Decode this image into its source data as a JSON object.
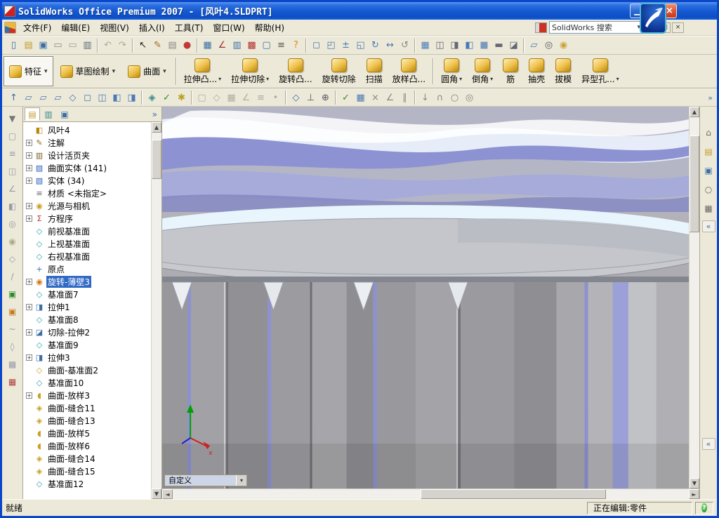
{
  "window": {
    "title": "SolidWorks Office Premium 2007 - [风叶4.SLDPRT]"
  },
  "titlebar": {
    "buttons": [
      {
        "name": "minimize-button",
        "glyph": "▁"
      },
      {
        "name": "restore-button",
        "glyph": "▢"
      },
      {
        "name": "close-button",
        "glyph": "×"
      }
    ]
  },
  "menubar": {
    "items": [
      "文件(F)",
      "编辑(E)",
      "视图(V)",
      "插入(I)",
      "工具(T)",
      "窗口(W)",
      "帮助(H)"
    ],
    "search": {
      "value": "SolidWorks 搜索",
      "arrow": "▾"
    },
    "mdi": [
      {
        "name": "mdi-minimize-button",
        "glyph": "–"
      },
      {
        "name": "mdi-restore-button",
        "glyph": "▢"
      },
      {
        "name": "mdi-close-button",
        "glyph": "×"
      }
    ]
  },
  "toolbar_standard": [
    {
      "n": "new-file-icon",
      "g": "▯",
      "c": "#3a6ea5"
    },
    {
      "n": "open-file-icon",
      "g": "▤",
      "c": "#c49a2e"
    },
    {
      "n": "save-icon",
      "g": "▣",
      "c": "#3a6ea5"
    },
    {
      "n": "make-drawing-icon",
      "g": "▭",
      "c": "#8a8a8a"
    },
    {
      "n": "make-assembly-icon",
      "g": "▭",
      "c": "#9a9a9a"
    },
    {
      "n": "print-icon",
      "g": "▥",
      "c": "#5a6a7a"
    },
    {
      "s": 1
    },
    {
      "n": "undo-icon",
      "g": "↶",
      "c": "#b0aa98"
    },
    {
      "n": "redo-icon",
      "g": "↷",
      "c": "#b0aa98"
    },
    {
      "s": 1
    },
    {
      "n": "select-icon",
      "g": "↖",
      "c": "#222222"
    },
    {
      "n": "sketch-pencil-icon",
      "g": "✎",
      "c": "#a06a20"
    },
    {
      "n": "note-icon",
      "g": "▤",
      "c": "#888888"
    },
    {
      "n": "rebuild-icon",
      "g": "●",
      "c": "#c03838"
    },
    {
      "s": 1
    },
    {
      "n": "grid-icon",
      "g": "▦",
      "c": "#3a6ea5"
    },
    {
      "n": "dimension-icon",
      "g": "∠",
      "c": "#a03030"
    },
    {
      "n": "design-table-icon",
      "g": "▥",
      "c": "#3a6ea5"
    },
    {
      "n": "toolbox-icon",
      "g": "▩",
      "c": "#b03030"
    },
    {
      "n": "window-icon",
      "g": "▢",
      "c": "#3a6ea5"
    },
    {
      "n": "options-icon",
      "g": "≡",
      "c": "#555555"
    },
    {
      "n": "help-icon",
      "g": "?",
      "c": "#e08a00"
    },
    {
      "s": 1
    },
    {
      "n": "zoom-fit-icon",
      "g": "◻",
      "c": "#4a7ab5"
    },
    {
      "n": "zoom-area-icon",
      "g": "◰",
      "c": "#4a7ab5"
    },
    {
      "n": "zoom-in-out-icon",
      "g": "±",
      "c": "#4a7ab5"
    },
    {
      "n": "zoom-selection-icon",
      "g": "◱",
      "c": "#4a7ab5"
    },
    {
      "n": "rotate-view-icon",
      "g": "↻",
      "c": "#4a7ab5"
    },
    {
      "n": "pan-icon",
      "g": "↔",
      "c": "#4a7ab5"
    },
    {
      "n": "previous-view-icon",
      "g": "↺",
      "c": "#888888"
    },
    {
      "s": 1
    },
    {
      "n": "standard-views-icon",
      "g": "▦",
      "c": "#4a7ab5"
    },
    {
      "n": "wireframe-icon",
      "g": "◫",
      "c": "#666677"
    },
    {
      "n": "hidden-lines-icon",
      "g": "◨",
      "c": "#666677"
    },
    {
      "n": "shaded-edges-icon",
      "g": "◧",
      "c": "#4a7ab5"
    },
    {
      "n": "shaded-icon",
      "g": "■",
      "c": "#7a9ac0"
    },
    {
      "n": "shadow-icon",
      "g": "▬",
      "c": "#666677"
    },
    {
      "n": "section-view-icon",
      "g": "◪",
      "c": "#666677"
    },
    {
      "s": 1
    },
    {
      "n": "view-orientation-icon",
      "g": "▱",
      "c": "#4a7ab5"
    },
    {
      "n": "camera-icon",
      "g": "◎",
      "c": "#555566"
    },
    {
      "n": "appearance-icon",
      "g": "◉",
      "c": "#caa23a"
    }
  ],
  "command_manager": {
    "tabs": [
      {
        "label": "特征",
        "name": "tab-features",
        "active": true,
        "arrow": "▾"
      },
      {
        "label": "草图绘制",
        "name": "tab-sketch",
        "active": false,
        "arrow": "▾"
      },
      {
        "label": "曲面",
        "name": "tab-surfaces",
        "active": false,
        "arrow": "▾"
      }
    ],
    "buttons": [
      {
        "label": "拉伸凸...",
        "name": "extruded-boss-button",
        "arrow": true
      },
      {
        "label": "拉伸切除",
        "name": "extruded-cut-button",
        "arrow": true
      },
      {
        "label": "旋转凸...",
        "name": "revolved-boss-button",
        "arrow": false
      },
      {
        "label": "旋转切除",
        "name": "revolved-cut-button",
        "arrow": false
      },
      {
        "label": "扫描",
        "name": "sweep-button",
        "arrow": false
      },
      {
        "label": "放样凸...",
        "name": "loft-button",
        "arrow": false,
        "sep_after": true
      },
      {
        "label": "圆角",
        "name": "fillet-button",
        "arrow": true
      },
      {
        "label": "倒角",
        "name": "chamfer-button",
        "arrow": true
      },
      {
        "label": "筋",
        "name": "rib-button",
        "arrow": false
      },
      {
        "label": "抽壳",
        "name": "shell-button",
        "arrow": false
      },
      {
        "label": "拔模",
        "name": "draft-button",
        "arrow": false
      },
      {
        "label": "异型孔...",
        "name": "hole-wizard-button",
        "arrow": true
      }
    ]
  },
  "toolbar_view": [
    {
      "n": "normal-to-icon",
      "g": "↑",
      "c": "#3a6ea5"
    },
    {
      "n": "front-plane-icon",
      "g": "▱",
      "c": "#4a7ab5"
    },
    {
      "n": "top-plane-icon",
      "g": "▱",
      "c": "#4a7ab5"
    },
    {
      "n": "right-plane-icon",
      "g": "▱",
      "c": "#4a7ab5"
    },
    {
      "n": "iso-view-icon",
      "g": "◇",
      "c": "#4a7ab5"
    },
    {
      "n": "cube-view-1-icon",
      "g": "◻",
      "c": "#4a7ab5"
    },
    {
      "n": "cube-view-2-icon",
      "g": "◫",
      "c": "#4a7ab5"
    },
    {
      "n": "cube-view-3-icon",
      "g": "◧",
      "c": "#4a7ab5"
    },
    {
      "n": "cube-view-4-icon",
      "g": "◨",
      "c": "#4a7ab5"
    },
    {
      "s": 1
    },
    {
      "n": "display-style-icon",
      "g": "◈",
      "c": "#3a8a8a"
    },
    {
      "n": "hide-show-icon",
      "g": "✓",
      "c": "#2a8a2a"
    },
    {
      "n": "appearance-star-icon",
      "g": "✱",
      "c": "#b8a020"
    },
    {
      "s": 1
    },
    {
      "n": "sketch-snap-icon",
      "g": "▢",
      "c": "#b2ae9e"
    },
    {
      "n": "quick-snap-icon",
      "g": "◇",
      "c": "#b2ae9e"
    },
    {
      "n": "grid-snap-icon",
      "g": "▦",
      "c": "#b2ae9e"
    },
    {
      "n": "angle-snap-icon",
      "g": "∠",
      "c": "#b2ae9e"
    },
    {
      "n": "length-snap-icon",
      "g": "≡",
      "c": "#b2ae9e"
    },
    {
      "n": "midpoint-snap-icon",
      "g": "•",
      "c": "#b2ae9e"
    },
    {
      "s": 1
    },
    {
      "n": "polygon-icon",
      "g": "◇",
      "c": "#3a6ea5"
    },
    {
      "n": "datum-icon",
      "g": "⊥",
      "c": "#555566"
    },
    {
      "n": "anchor-icon",
      "g": "⊕",
      "c": "#555566"
    },
    {
      "s": 1
    },
    {
      "n": "green-check-icon",
      "g": "✓",
      "c": "#2a8a2a"
    },
    {
      "n": "layout-icon",
      "g": "▦",
      "c": "#4a7ab5"
    },
    {
      "n": "close-sketch-icon",
      "g": "×",
      "c": "#888888"
    },
    {
      "n": "angle-measure-icon",
      "g": "∠",
      "c": "#888888"
    },
    {
      "n": "parallel-icon",
      "g": "∥",
      "c": "#888888"
    },
    {
      "s": 1
    },
    {
      "n": "arrow-down-icon",
      "g": "↓",
      "c": "#888888"
    },
    {
      "n": "arc-icon",
      "g": "∩",
      "c": "#888888"
    },
    {
      "n": "circle-icon",
      "g": "○",
      "c": "#888888"
    },
    {
      "n": "target-icon",
      "g": "◎",
      "c": "#888888"
    }
  ],
  "toolbar_overflow_glyph": "»",
  "left_strip": [
    {
      "n": "selection-filter-icon",
      "g": "▼",
      "c": "#777777"
    },
    {
      "n": "document-strip-icon",
      "g": "▢",
      "c": "#9999aa"
    },
    {
      "n": "layers-strip-icon",
      "g": "≡",
      "c": "#9999aa"
    },
    {
      "n": "view-settings-strip-icon",
      "g": "◫",
      "c": "#9999aa"
    },
    {
      "n": "measure-strip-icon",
      "g": "∠",
      "c": "#9999aa"
    },
    {
      "n": "section-strip-icon",
      "g": "◧",
      "c": "#9999aa"
    },
    {
      "n": "camera-strip-icon",
      "g": "◎",
      "c": "#9999aa"
    },
    {
      "n": "lights-strip-icon",
      "g": "◉",
      "c": "#aaaa88"
    },
    {
      "n": "planes-strip-icon",
      "g": "◇",
      "c": "#9999aa"
    },
    {
      "n": "axis-strip-icon",
      "g": "/",
      "c": "#9999aa"
    },
    {
      "n": "green-feature-strip-icon",
      "g": "▣",
      "c": "#2a8a2a"
    },
    {
      "n": "orange-feature-strip-icon",
      "g": "▣",
      "c": "#c87820"
    },
    {
      "n": "curve-strip-icon",
      "g": "~",
      "c": "#9999aa"
    },
    {
      "n": "mate-strip-icon",
      "g": "◊",
      "c": "#9999aa"
    },
    {
      "n": "tools-strip-icon",
      "g": "▩",
      "c": "#9999aa"
    },
    {
      "n": "palette-strip-icon",
      "g": "▦",
      "c": "#b04040"
    }
  ],
  "feature_tree": {
    "tabs": [
      {
        "name": "feature-manager-tab",
        "glyph": "▤",
        "color": "#c49a2e",
        "active": true
      },
      {
        "name": "property-manager-tab",
        "glyph": "▥",
        "color": "#3a8a8a",
        "active": false
      },
      {
        "name": "configuration-manager-tab",
        "glyph": "▣",
        "color": "#3a6ea5",
        "active": false
      }
    ],
    "expand_glyph": "»",
    "items": [
      {
        "label": "风叶4",
        "icon": "part-icon"
      },
      {
        "label": "注解",
        "icon": "annotations-icon",
        "exp": true
      },
      {
        "label": "设计活页夹",
        "icon": "design-binder-icon",
        "exp": true
      },
      {
        "label": "曲面实体 (141)",
        "icon": "surface-bodies-folder-icon",
        "exp": true
      },
      {
        "label": "实体 (34)",
        "icon": "solid-bodies-folder-icon",
        "exp": true
      },
      {
        "label": "材质 <未指定>",
        "icon": "material-icon"
      },
      {
        "label": "光源与相机",
        "icon": "lights-cameras-icon",
        "exp": true
      },
      {
        "label": "方程序",
        "icon": "equations-icon",
        "exp": true
      },
      {
        "label": "前视基准面",
        "icon": "plane-icon"
      },
      {
        "label": "上视基准面",
        "icon": "plane-icon"
      },
      {
        "label": "右视基准面",
        "icon": "plane-icon"
      },
      {
        "label": "原点",
        "icon": "origin-icon"
      },
      {
        "label": "旋转-薄壁3",
        "icon": "revolve-icon",
        "exp": true,
        "selected": true
      },
      {
        "label": "基准面7",
        "icon": "plane-icon"
      },
      {
        "label": "拉伸1",
        "icon": "extrude-icon",
        "exp": true
      },
      {
        "label": "基准面8",
        "icon": "plane-icon"
      },
      {
        "label": "切除-拉伸2",
        "icon": "cut-extrude-icon",
        "exp": true
      },
      {
        "label": "基准面9",
        "icon": "plane-icon"
      },
      {
        "label": "拉伸3",
        "icon": "extrude-icon",
        "exp": true
      },
      {
        "label": "曲面-基准面2",
        "icon": "surface-plane-icon"
      },
      {
        "label": "基准面10",
        "icon": "plane-icon"
      },
      {
        "label": "曲面-放样3",
        "icon": "surface-loft-icon",
        "exp": true
      },
      {
        "label": "曲面-缝合11",
        "icon": "surface-knit-icon"
      },
      {
        "label": "曲面-缝合13",
        "icon": "surface-knit-icon"
      },
      {
        "label": "曲面-放样5",
        "icon": "surface-loft-icon"
      },
      {
        "label": "曲面-放样6",
        "icon": "surface-loft-icon"
      },
      {
        "label": "曲面-缝合14",
        "icon": "surface-knit-icon"
      },
      {
        "label": "曲面-缝合15",
        "icon": "surface-knit-icon"
      },
      {
        "label": "基准面12",
        "icon": "plane-icon"
      }
    ]
  },
  "right_panel": {
    "icons": [
      {
        "n": "home-icon",
        "g": "⌂",
        "c": "#6a6a6a"
      },
      {
        "n": "design-library-icon",
        "g": "▤",
        "c": "#c49a2e"
      },
      {
        "n": "file-explorer-icon",
        "g": "▣",
        "c": "#3a6ea5"
      },
      {
        "n": "search-icon",
        "g": "○",
        "c": "#666666"
      },
      {
        "n": "view-palette-icon",
        "g": "▦",
        "c": "#666666"
      }
    ],
    "collapse_top": "«",
    "collapse_bottom": "«"
  },
  "viewport": {
    "view_selector": "自定义",
    "selector_arrow": "▾"
  },
  "status": {
    "left": "就绪",
    "mode": "正在编辑:零件",
    "help": "?"
  }
}
